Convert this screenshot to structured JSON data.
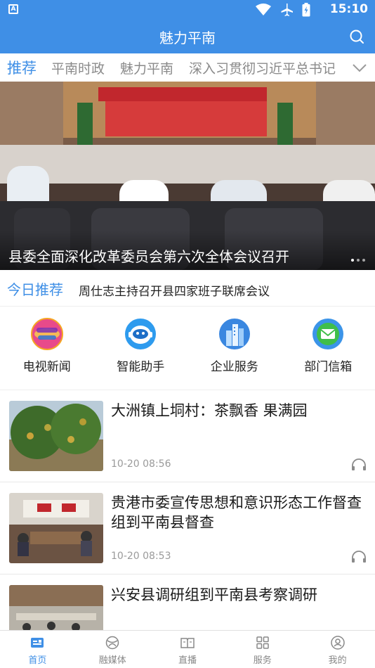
{
  "status_bar": {
    "time": "15:10",
    "left_icon": "a-notification-icon",
    "icons": [
      "wifi-icon",
      "airplane-icon",
      "battery-icon"
    ]
  },
  "app_bar": {
    "title": "魅力平南",
    "search_icon": "search-icon"
  },
  "tabs": [
    {
      "label": "推荐",
      "active": true
    },
    {
      "label": "平南时政",
      "active": false
    },
    {
      "label": "魅力平南",
      "active": false
    },
    {
      "label": "深入习贯彻习近平总书记",
      "active": false
    }
  ],
  "banner": {
    "caption": "县委全面深化改革委员会第六次全体会议召开",
    "slide_count": 3,
    "current_slide": 1
  },
  "today": {
    "label": "今日推荐",
    "text": "周仕志主持召开县四家班子联席会议"
  },
  "services": [
    {
      "label": "电视新闻",
      "icon": "tv-news-icon"
    },
    {
      "label": "智能助手",
      "icon": "robot-assistant-icon"
    },
    {
      "label": "企业服务",
      "icon": "building-icon"
    },
    {
      "label": "部门信箱",
      "icon": "mail-icon"
    }
  ],
  "news": [
    {
      "headline": "大洲镇上垌村：茶飘香 果满园",
      "date": "10-20 08:56"
    },
    {
      "headline": "贵港市委宣传思想和意识形态工作督查组到平南县督查",
      "date": "10-20 08:53"
    },
    {
      "headline": "兴安县调研组到平南县考察调研",
      "date": ""
    }
  ],
  "bottom_nav": [
    {
      "label": "首页",
      "icon": "home-icon",
      "active": true
    },
    {
      "label": "融媒体",
      "icon": "media-icon",
      "active": false
    },
    {
      "label": "直播",
      "icon": "live-icon",
      "active": false
    },
    {
      "label": "服务",
      "icon": "grid-icon",
      "active": false
    },
    {
      "label": "我的",
      "icon": "profile-icon",
      "active": false
    }
  ],
  "colors": {
    "primary": "#3f8fe6",
    "tab_inactive": "#8a8a8a",
    "date_gray": "#9a9a9a"
  }
}
